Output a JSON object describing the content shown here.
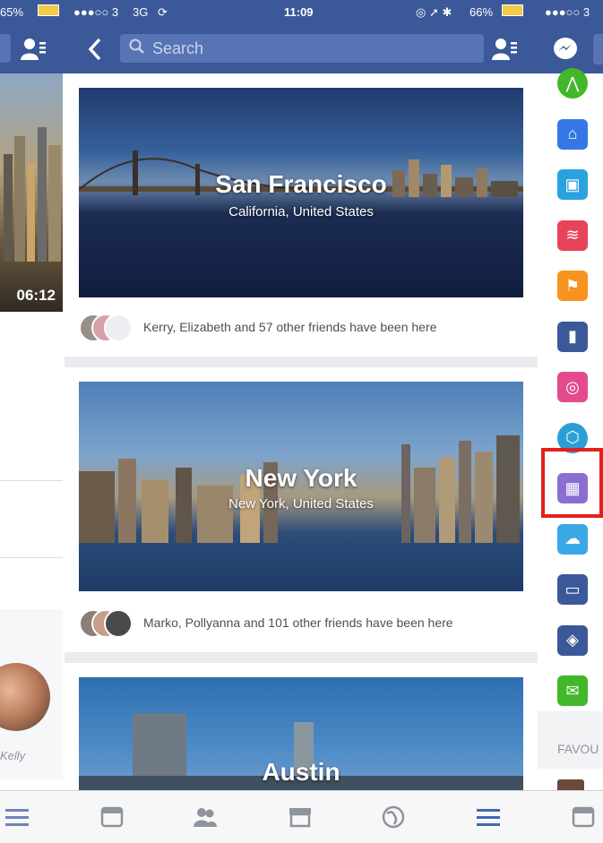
{
  "status_bar": {
    "left_battery": "65%",
    "carrier": "●●●○○ 3",
    "network": "3G",
    "time": "11:09",
    "battery": "66%",
    "right_carrier": "●●●○○ 3"
  },
  "nav": {
    "search_placeholder": "Search"
  },
  "left_panel": {
    "video_time": "06:12",
    "friend_name": "Kelly"
  },
  "places": [
    {
      "title": "San Francisco",
      "subtitle": "California, United States",
      "friends_text": "Kerry, Elizabeth and 57 other friends have been here"
    },
    {
      "title": "New York",
      "subtitle": "New York, United States",
      "friends_text": "Marko, Pollyanna and 101 other friends have been here"
    },
    {
      "title": "Austin"
    }
  ],
  "right_menu": {
    "favourites_label": "FAVOU",
    "icons": [
      {
        "name": "moves-app-icon",
        "color": "#42b72a"
      },
      {
        "name": "home-icon",
        "color": "#3578e5"
      },
      {
        "name": "contact-card-icon",
        "color": "#29a3e0"
      },
      {
        "name": "wifi-icon",
        "color": "#e8435a"
      },
      {
        "name": "flag-icon",
        "color": "#f7931e"
      },
      {
        "name": "bookmark-icon",
        "color": "#3b5998"
      },
      {
        "name": "target-icon",
        "color": "#e44b8d"
      },
      {
        "name": "shield-icon",
        "color": "#2a9fd6"
      },
      {
        "name": "city-guides-icon",
        "color": "#8a6fd1"
      },
      {
        "name": "weather-icon",
        "color": "#3ba8e6"
      },
      {
        "name": "tv-icon",
        "color": "#3b5998"
      },
      {
        "name": "cube-icon",
        "color": "#3b5998"
      },
      {
        "name": "discover-icon",
        "color": "#42b72a"
      }
    ]
  }
}
